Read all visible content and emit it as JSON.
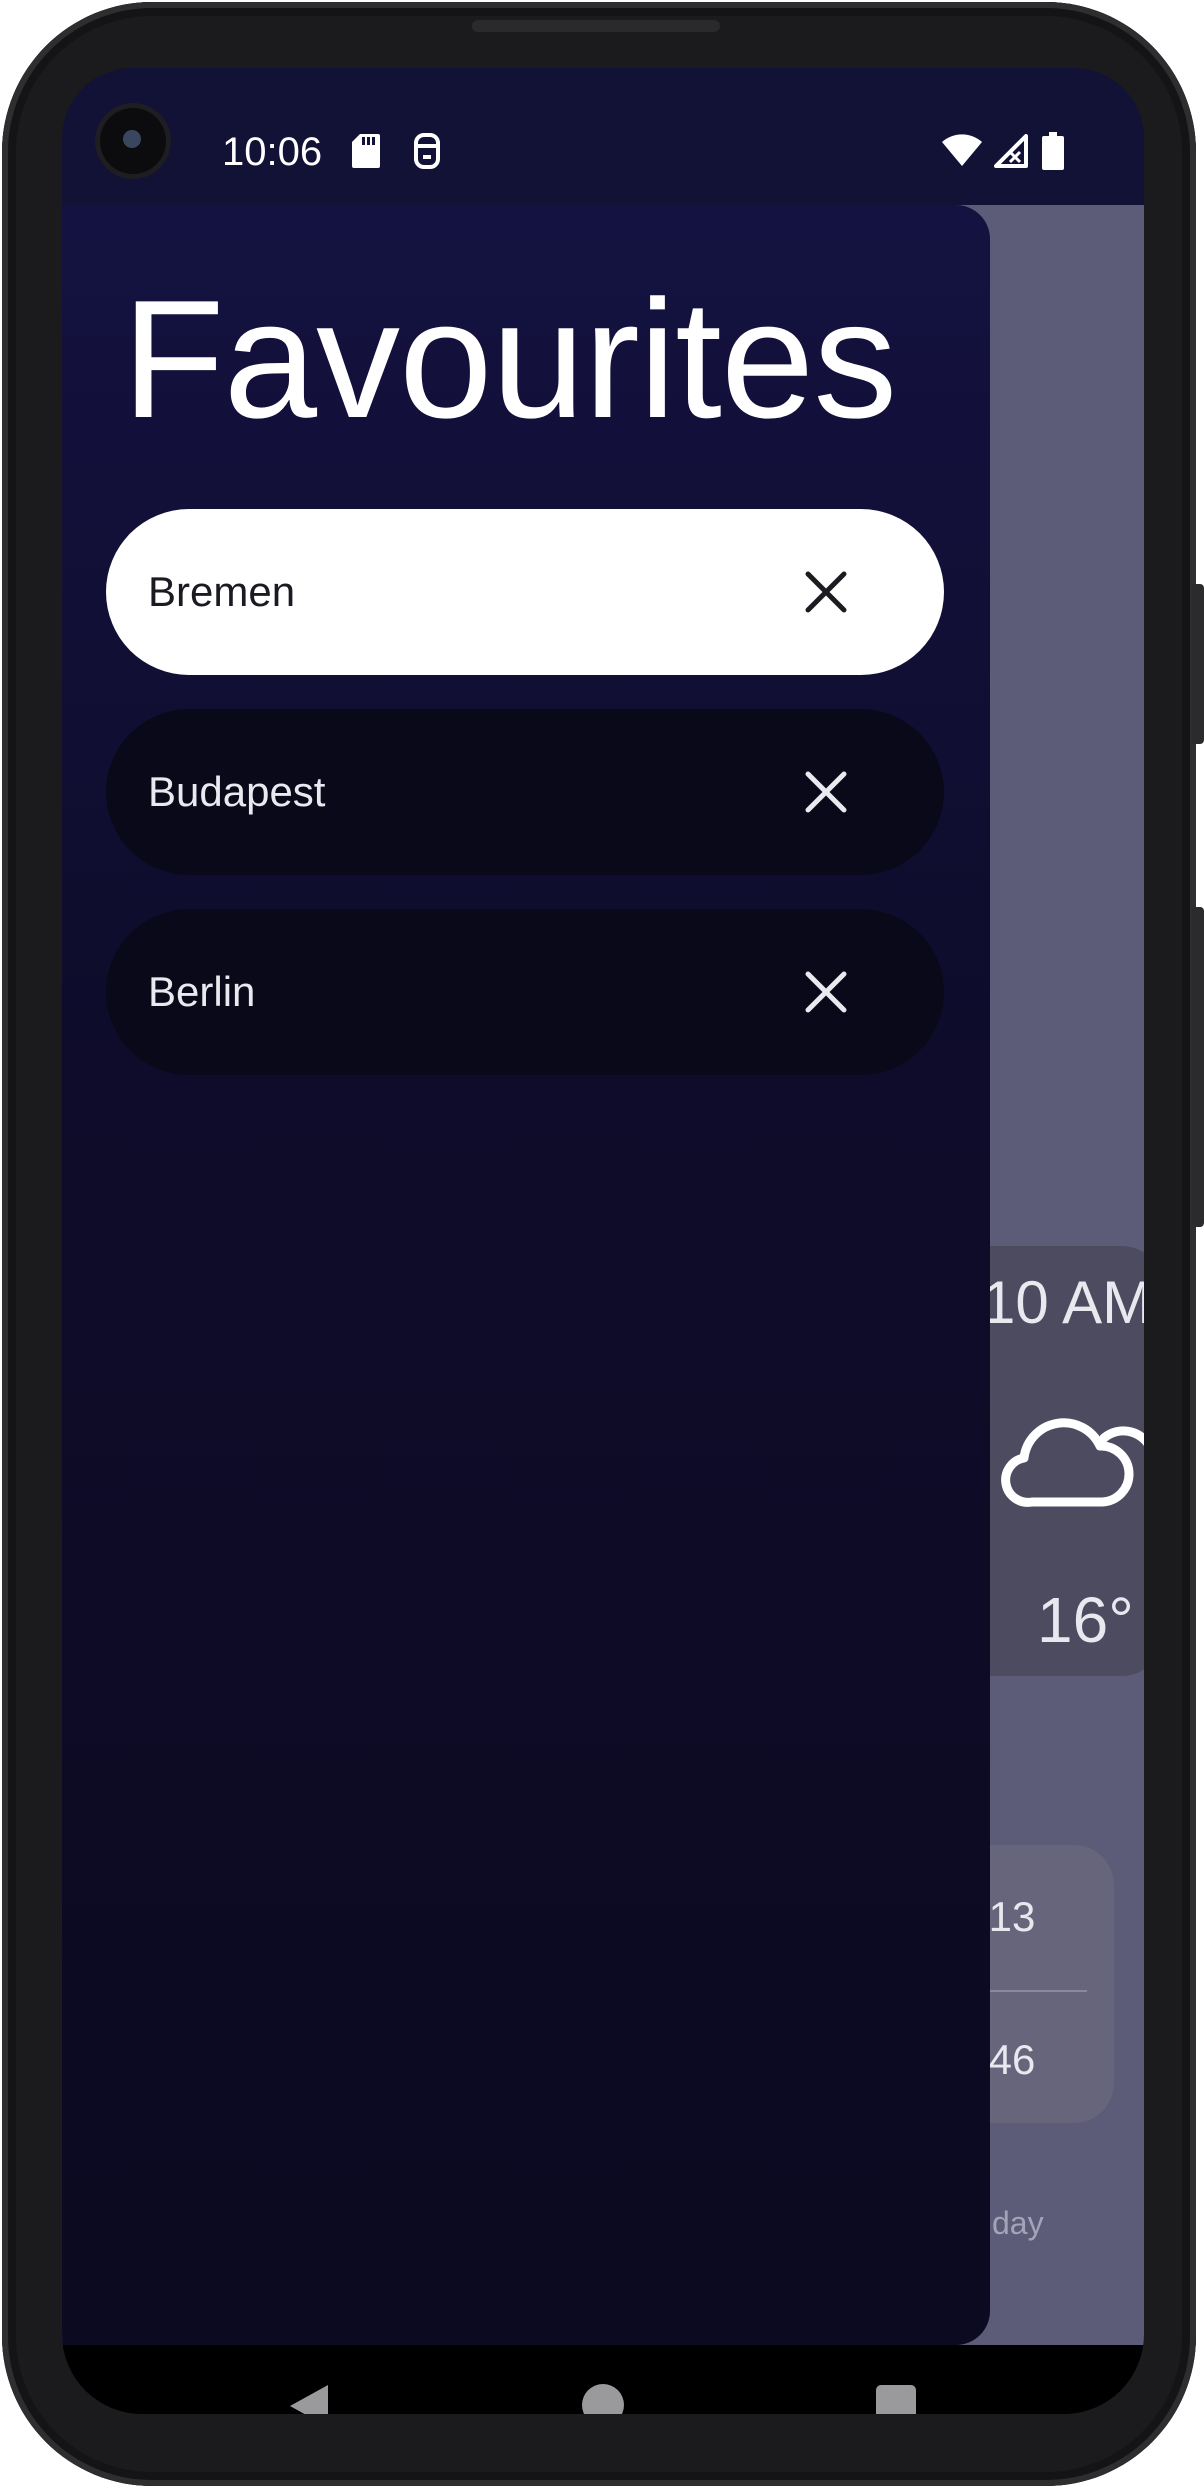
{
  "status_bar": {
    "time": "10:06",
    "icons": [
      "sd-card-icon",
      "face-icon",
      "wifi-icon",
      "signal-icon",
      "battery-icon"
    ]
  },
  "drawer": {
    "title": "Favourites",
    "items": [
      {
        "label": "Bremen",
        "selected": true
      },
      {
        "label": "Budapest",
        "selected": false
      },
      {
        "label": "Berlin",
        "selected": false
      }
    ],
    "close_icon": "close-icon"
  },
  "background_app": {
    "hour_time": "10 AM",
    "hour_temp": "16°",
    "hour_icon": "cloud-icon",
    "sunrise": ":13",
    "sunset": ":46",
    "footer_text": "day"
  },
  "nav_bar": {
    "buttons": [
      "back-icon",
      "home-icon",
      "recents-icon"
    ]
  },
  "colors": {
    "drawer_bg": "#121136",
    "item_bg": "#0a0919",
    "selected_item_bg": "#ffffff",
    "scrim": "#5d5c78"
  }
}
